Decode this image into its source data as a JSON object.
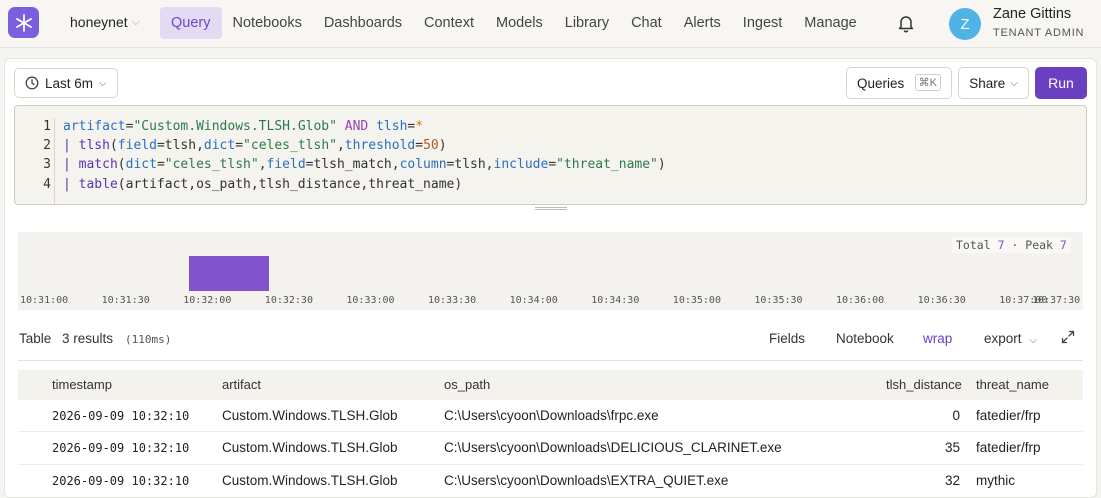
{
  "nav": {
    "tenant": "honeynet",
    "items": [
      "Query",
      "Notebooks",
      "Dashboards",
      "Context",
      "Models",
      "Library",
      "Chat",
      "Alerts",
      "Ingest",
      "Manage"
    ],
    "active": "Query"
  },
  "user": {
    "initial": "Z",
    "name": "Zane Gittins",
    "role": "TENANT ADMIN"
  },
  "toolbar": {
    "time_range": "Last 6m",
    "queries_label": "Queries",
    "queries_shortcut": "⌘K",
    "share_label": "Share",
    "run_label": "Run"
  },
  "editor": {
    "line_numbers": [
      "1",
      "2",
      "3",
      "4"
    ],
    "lines": [
      "artifact=\"Custom.Windows.TLSH.Glob\" AND tlsh=*",
      "| tlsh(field=tlsh,dict=\"celes_tlsh\",threshold=50)",
      "| match(dict=\"celes_tlsh\",field=tlsh_match,column=tlsh,include=\"threat_name\")",
      "| table(artifact,os_path,tlsh_distance,threat_name)"
    ]
  },
  "histogram": {
    "total_label": "Total",
    "total": "7",
    "peak_label": "Peak",
    "peak": "7",
    "ticks": [
      "10:31:00",
      "10:31:30",
      "10:32:00",
      "10:32:30",
      "10:33:00",
      "10:33:30",
      "10:34:00",
      "10:34:30",
      "10:35:00",
      "10:35:30",
      "10:36:00",
      "10:36:30",
      "10:37:00",
      "10:37:30"
    ]
  },
  "chart_data": {
    "type": "bar",
    "categories": [
      "10:32:00"
    ],
    "values": [
      7
    ],
    "ylim": [
      0,
      7
    ]
  },
  "results": {
    "view": "Table",
    "count": "3 results",
    "duration": "(110ms)",
    "actions": {
      "fields": "Fields",
      "notebook": "Notebook",
      "wrap": "wrap",
      "export": "export"
    },
    "columns": [
      "timestamp",
      "artifact",
      "os_path",
      "tlsh_distance",
      "threat_name"
    ],
    "rows": [
      [
        "2026-09-09 10:32:10",
        "Custom.Windows.TLSH.Glob",
        "C:\\Users\\cyoon\\Downloads\\frpc.exe",
        "0",
        "fatedier/frp"
      ],
      [
        "2026-09-09 10:32:10",
        "Custom.Windows.TLSH.Glob",
        "C:\\Users\\cyoon\\Downloads\\DELICIOUS_CLARINET.exe",
        "35",
        "fatedier/frp"
      ],
      [
        "2026-09-09 10:32:10",
        "Custom.Windows.TLSH.Glob",
        "C:\\Users\\cyoon\\Downloads\\EXTRA_QUIET.exe",
        "32",
        "mythic"
      ]
    ]
  },
  "colors": {
    "accent": "#6a3fc2",
    "bar": "#8253cc",
    "avatar": "#4fb3e6"
  }
}
